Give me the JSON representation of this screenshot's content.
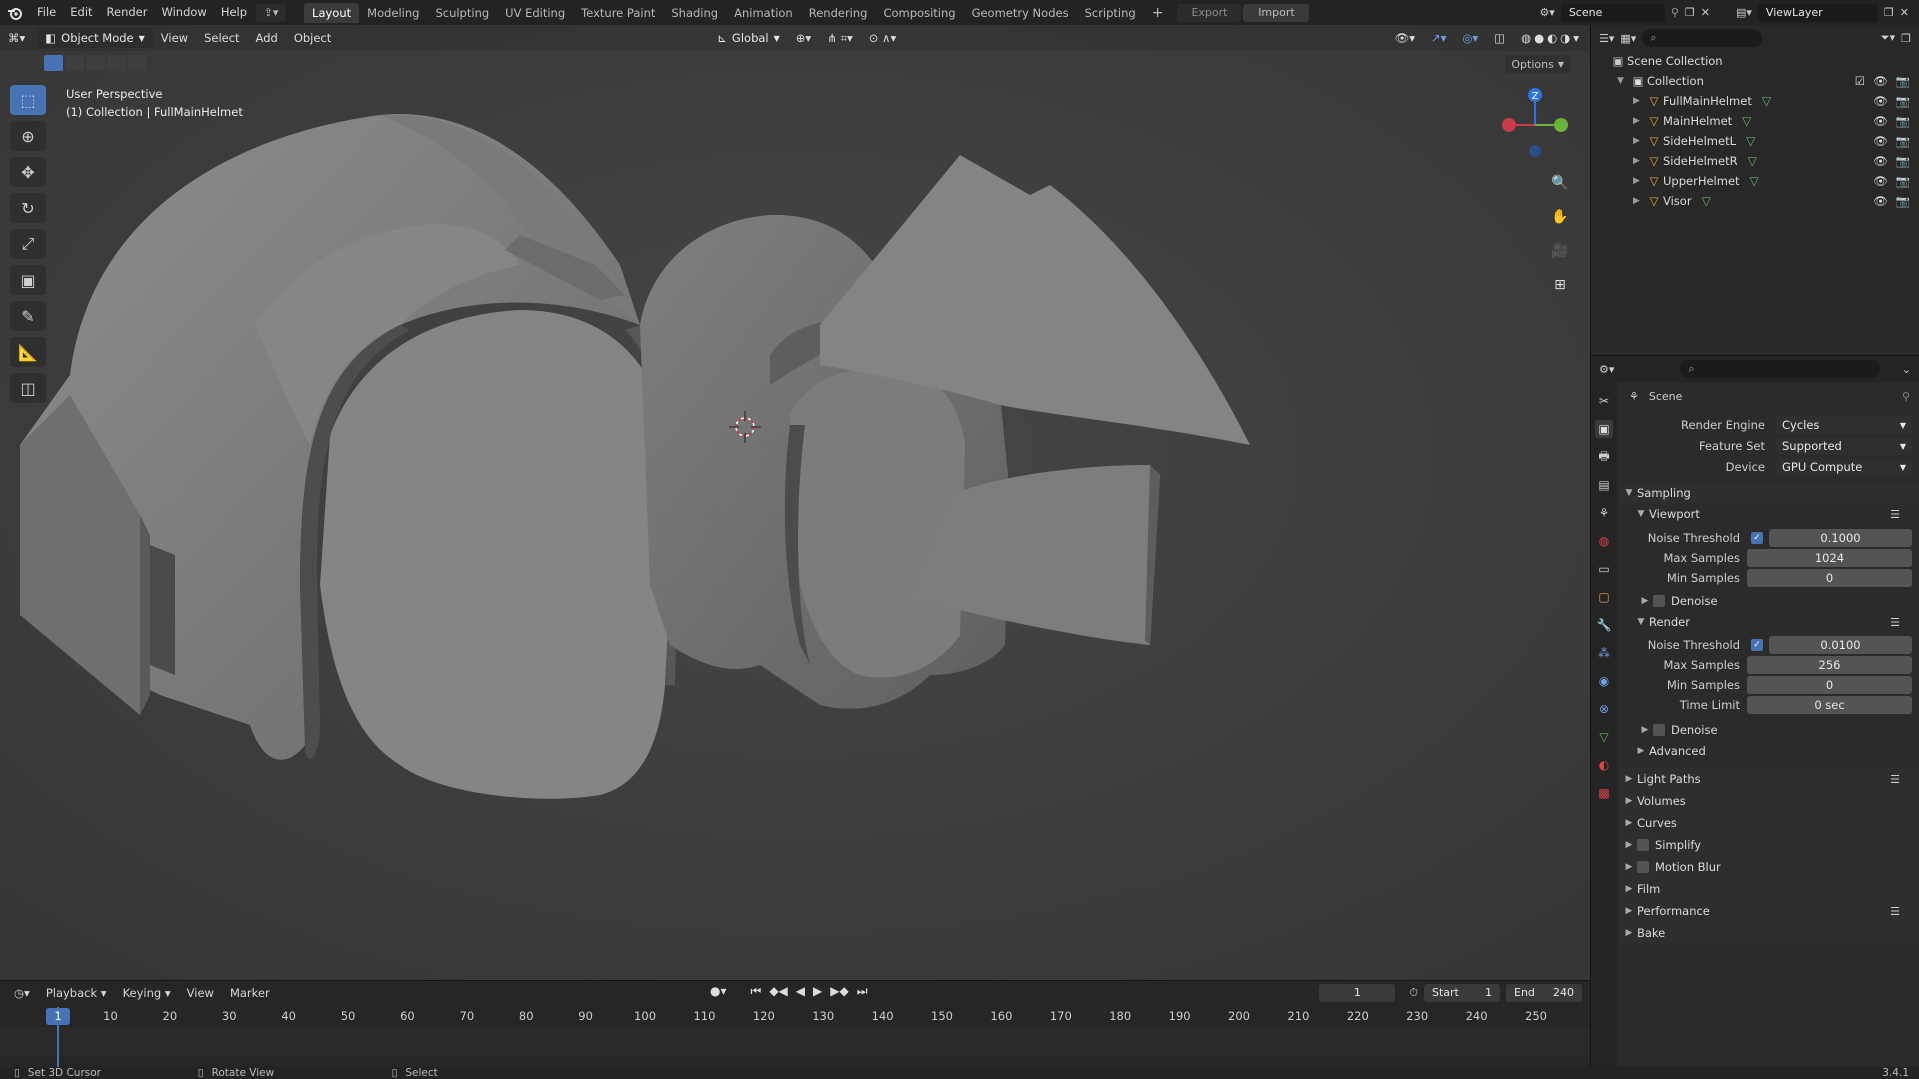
{
  "menu": {
    "items": [
      "File",
      "Edit",
      "Render",
      "Window",
      "Help"
    ],
    "workspaces": [
      "Layout",
      "Modeling",
      "Sculpting",
      "UV Editing",
      "Texture Paint",
      "Shading",
      "Animation",
      "Rendering",
      "Compositing",
      "Geometry Nodes",
      "Scripting"
    ],
    "active_workspace": "Layout",
    "export_label": "Export",
    "import_label": "Import",
    "scene_name": "Scene",
    "view_layer": "ViewLayer"
  },
  "viewport": {
    "mode": "Object Mode",
    "menus": [
      "View",
      "Select",
      "Add",
      "Object"
    ],
    "transform_orientation": "Global",
    "options_label": "Options",
    "perspective_text": "User Perspective",
    "collection_text": "(1) Collection | FullMainHelmet",
    "gizmo_axis_z": "Z"
  },
  "outliner": {
    "scene_collection": "Scene Collection",
    "collection": "Collection",
    "objects": [
      "FullMainHelmet",
      "MainHelmet",
      "SideHelmetL",
      "SideHelmetR",
      "UpperHelmet",
      "Visor"
    ]
  },
  "properties": {
    "context": "Scene",
    "render_engine_label": "Render Engine",
    "render_engine": "Cycles",
    "feature_set_label": "Feature Set",
    "feature_set": "Supported",
    "device_label": "Device",
    "device": "GPU Compute",
    "sampling": "Sampling",
    "viewport": {
      "title": "Viewport",
      "noise_threshold_label": "Noise Threshold",
      "noise_threshold": "0.1000",
      "max_samples_label": "Max Samples",
      "max_samples": "1024",
      "min_samples_label": "Min Samples",
      "min_samples": "0",
      "denoise": "Denoise"
    },
    "render": {
      "title": "Render",
      "noise_threshold_label": "Noise Threshold",
      "noise_threshold": "0.0100",
      "max_samples_label": "Max Samples",
      "max_samples": "256",
      "min_samples_label": "Min Samples",
      "min_samples": "0",
      "time_limit_label": "Time Limit",
      "time_limit": "0 sec",
      "denoise": "Denoise"
    },
    "advanced": "Advanced",
    "panels": [
      "Light Paths",
      "Volumes",
      "Curves",
      "Simplify",
      "Motion Blur",
      "Film",
      "Performance",
      "Bake"
    ]
  },
  "timeline": {
    "menus": [
      "Playback",
      "Keying",
      "View",
      "Marker"
    ],
    "current_frame": "1",
    "start_label": "Start",
    "start": "1",
    "end_label": "End",
    "end": "240",
    "ticks": [
      "10",
      "20",
      "30",
      "40",
      "50",
      "60",
      "70",
      "80",
      "90",
      "100",
      "110",
      "120",
      "130",
      "140",
      "150",
      "160",
      "170",
      "180",
      "190",
      "200",
      "210",
      "220",
      "230",
      "240",
      "250"
    ],
    "playhead_label": "1"
  },
  "status": {
    "left": "Set 3D Cursor",
    "middle": "Rotate View",
    "right": "Select",
    "version": "3.4.1"
  },
  "colors": {
    "accent": "#4772b3",
    "mesh_green": "#5dba5d",
    "object_orange": "#e8a24d"
  }
}
